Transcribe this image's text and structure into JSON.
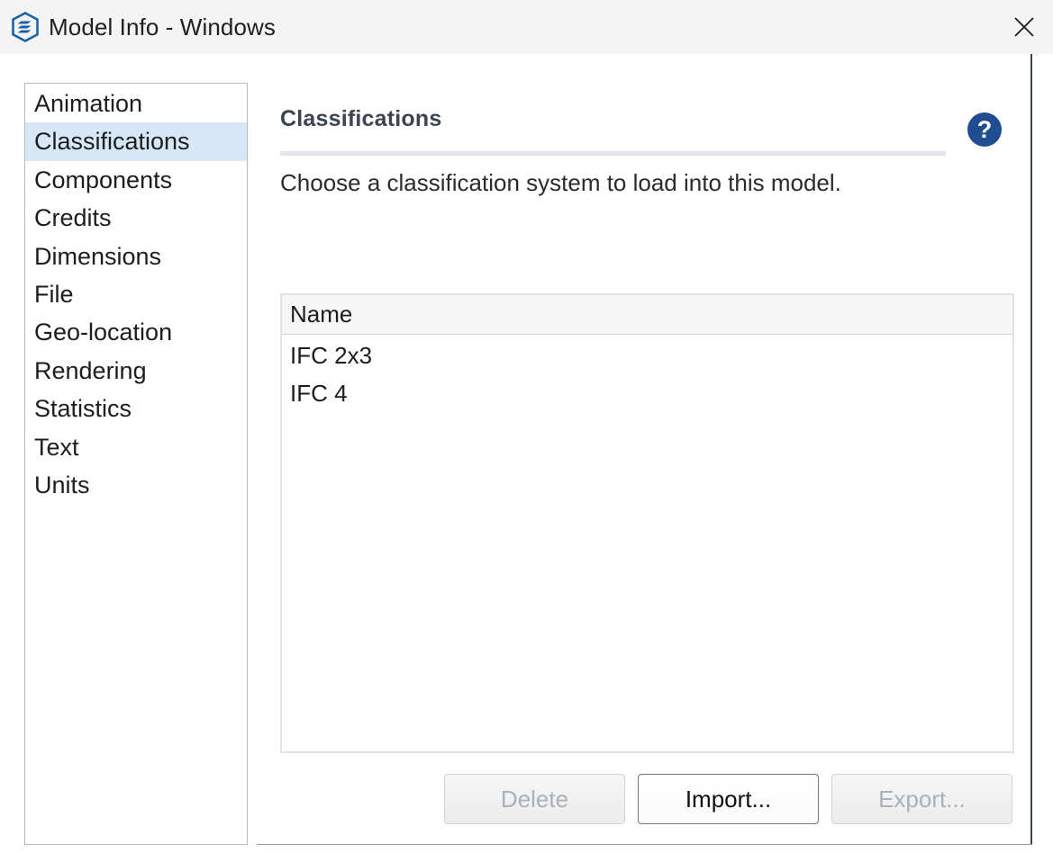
{
  "window": {
    "title": "Model Info - Windows",
    "logo_icon": "sketchup-logo-icon",
    "close_icon": "close-icon"
  },
  "sidebar": {
    "items": [
      {
        "label": "Animation",
        "selected": false
      },
      {
        "label": "Classifications",
        "selected": true
      },
      {
        "label": "Components",
        "selected": false
      },
      {
        "label": "Credits",
        "selected": false
      },
      {
        "label": "Dimensions",
        "selected": false
      },
      {
        "label": "File",
        "selected": false
      },
      {
        "label": "Geo-location",
        "selected": false
      },
      {
        "label": "Rendering",
        "selected": false
      },
      {
        "label": "Statistics",
        "selected": false
      },
      {
        "label": "Text",
        "selected": false
      },
      {
        "label": "Units",
        "selected": false
      }
    ]
  },
  "main": {
    "section_title": "Classifications",
    "help_icon": "help-question-icon",
    "description": "Choose a classification system to load into this model.",
    "table": {
      "columns": [
        "Name"
      ],
      "rows": [
        [
          "IFC 2x3"
        ],
        [
          "IFC 4"
        ]
      ]
    },
    "buttons": [
      {
        "label": "Delete",
        "enabled": false
      },
      {
        "label": "Import...",
        "enabled": true
      },
      {
        "label": "Export...",
        "enabled": false
      }
    ]
  },
  "colors": {
    "titlebar_bg": "#f4f4f4",
    "selection_bg": "#d6e8f7",
    "accent_blue": "#1b62a5",
    "help_blue": "#1f4d8f",
    "section_title": "#3b4450",
    "panel_border": "#3a4450"
  }
}
